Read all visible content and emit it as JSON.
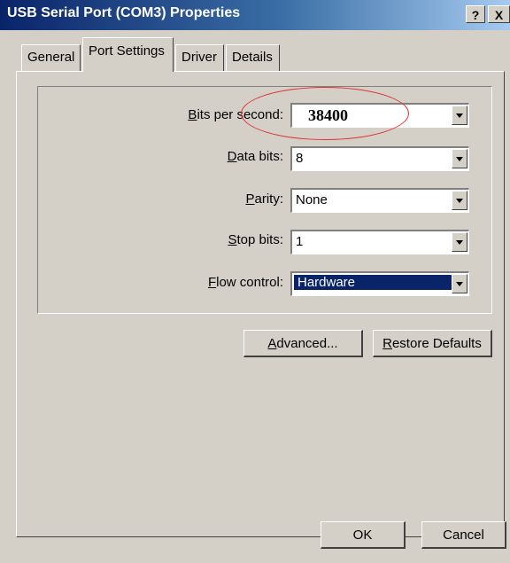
{
  "window": {
    "title": "USB Serial Port (COM3) Properties",
    "help_button": "?",
    "close_button": "X"
  },
  "tabs": [
    {
      "label": "General"
    },
    {
      "label": "Port Settings",
      "selected": true
    },
    {
      "label": "Driver"
    },
    {
      "label": "Details"
    }
  ],
  "port_settings": {
    "bits_per_second": {
      "label_mnemonic": "B",
      "label_rest": "its per second:",
      "value": "38400"
    },
    "data_bits": {
      "label_mnemonic": "D",
      "label_rest": "ata bits:",
      "value": "8"
    },
    "parity": {
      "label_mnemonic": "P",
      "label_rest": "arity:",
      "value": "None"
    },
    "stop_bits": {
      "label_mnemonic": "S",
      "label_rest": "top bits:",
      "value": "1"
    },
    "flow_control": {
      "label_mnemonic": "F",
      "label_rest": "low control:",
      "value": "Hardware"
    }
  },
  "buttons": {
    "advanced": {
      "mnemonic": "A",
      "rest": "dvanced..."
    },
    "restore_defaults": {
      "mnemonic": "R",
      "rest": "estore Defaults"
    },
    "ok": "OK",
    "cancel": "Cancel"
  },
  "colors": {
    "highlight_circle": "#e03030",
    "selection": "#0a246a"
  }
}
